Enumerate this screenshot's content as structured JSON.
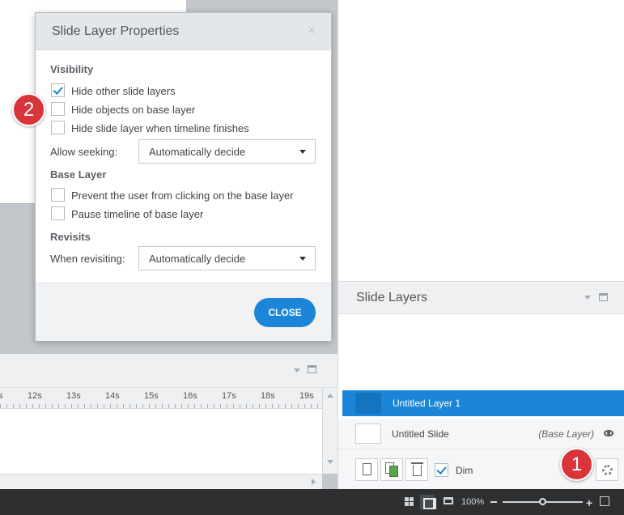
{
  "dialog": {
    "title": "Slide Layer Properties",
    "close_x": "×",
    "visibility": {
      "title": "Visibility",
      "options": [
        {
          "label": "Hide other slide layers",
          "checked": true
        },
        {
          "label": "Hide objects on base layer",
          "checked": false
        },
        {
          "label": "Hide slide layer when timeline finishes",
          "checked": false
        }
      ],
      "seeking_label": "Allow seeking:",
      "seeking_value": "Automatically decide"
    },
    "base_layer": {
      "title": "Base Layer",
      "options": [
        {
          "label": "Prevent the user from clicking on the base layer",
          "checked": false
        },
        {
          "label": "Pause timeline of base layer",
          "checked": false
        }
      ]
    },
    "revisits": {
      "title": "Revisits",
      "when_label": "When revisiting:",
      "when_value": "Automatically decide"
    },
    "close_button": "CLOSE"
  },
  "slide_layers": {
    "title": "Slide Layers",
    "layers": [
      {
        "name": "Untitled Layer 1",
        "selected": true
      },
      {
        "name": "Untitled Slide",
        "tag": "(Base Layer)"
      }
    ],
    "dim_label": "Dim",
    "dim_checked": true
  },
  "timeline": {
    "ticks": [
      "s",
      "12s",
      "13s",
      "14s",
      "15s",
      "16s",
      "17s",
      "18s",
      "19s"
    ]
  },
  "status_bar": {
    "zoom": "100%",
    "minus": "−",
    "plus": "+"
  },
  "callouts": [
    "1",
    "2"
  ],
  "colors": {
    "accent": "#1b86d8",
    "callout": "#d9343a",
    "status_bar": "#2d2f31"
  }
}
